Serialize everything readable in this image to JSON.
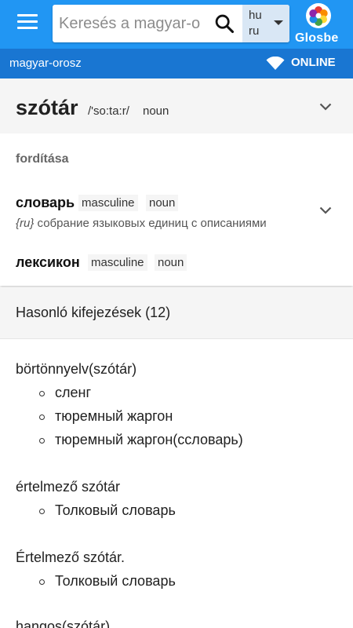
{
  "app": {
    "logo_text": "Glosbe",
    "brand_color": "#2196f3",
    "strip_color": "#1976d2"
  },
  "search": {
    "placeholder": "Keresés a magyar-o",
    "lang_from": "hu",
    "lang_to": "ru"
  },
  "strip": {
    "pair": "magyar-orosz",
    "status": "ONLINE"
  },
  "entry": {
    "headword": "szótár",
    "ipa": "/'so:ta:r/",
    "pos": "noun"
  },
  "translations": {
    "section_label": "fordítása",
    "items": [
      {
        "word": "словарь",
        "gender": "masculine",
        "pos": "noun",
        "example_lang": "{ru}",
        "example": " собрание языковых единиц с описаниями"
      },
      {
        "word": "лексикон",
        "gender": "masculine",
        "pos": "noun"
      }
    ]
  },
  "similar": {
    "title": "Hasonló kifejezések (12)",
    "entries": [
      {
        "term": "börtönnyelv(szótár)",
        "translations": [
          "сленг",
          "тюремный жаргон",
          "тюремный жаргон(ссловарь)"
        ]
      },
      {
        "term": "értelmező szótár",
        "translations": [
          "Толковый словарь"
        ]
      },
      {
        "term": "Értelmező szótár.",
        "translations": [
          "Толковый словарь"
        ]
      },
      {
        "term": "hangos(szótár)",
        "translations": []
      }
    ]
  },
  "icons": {
    "menu": "hamburger-menu-icon",
    "search": "search-icon",
    "dropdown": "dropdown-arrow-icon",
    "logo": "glosbe-logo-icon",
    "wifi": "wifi-icon",
    "expand": "chevron-down-icon"
  }
}
